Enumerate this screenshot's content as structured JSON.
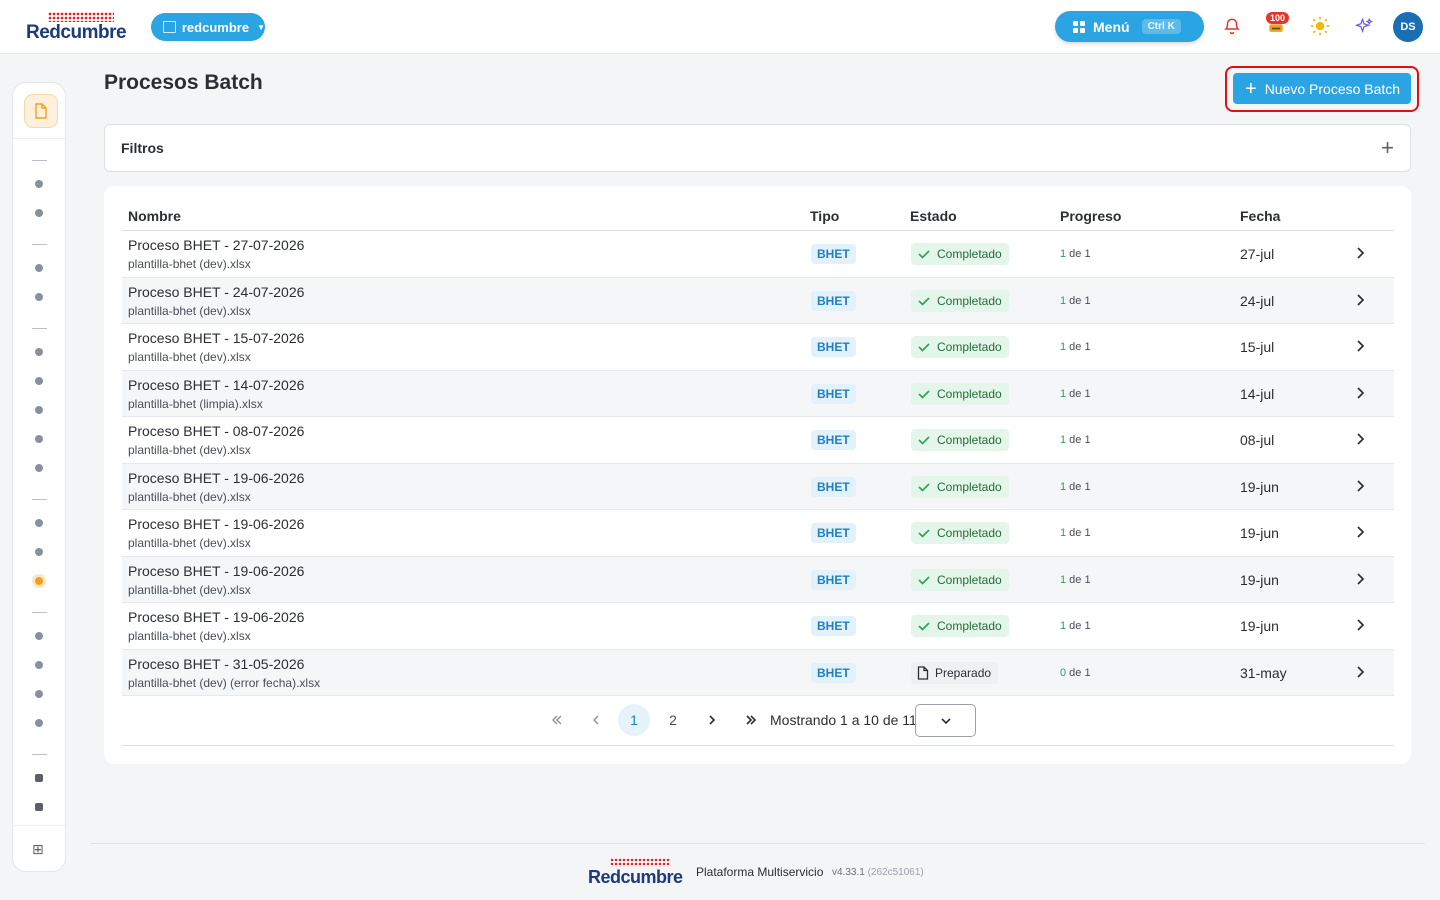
{
  "header": {
    "logo_text": "Redcumbre",
    "org_selector": "redcumbre",
    "menu_label": "Menú",
    "menu_shortcut": "Ctrl K",
    "notification_count": "100",
    "avatar_initials": "DS"
  },
  "page": {
    "title": "Procesos Batch",
    "new_button": "Nuevo Proceso Batch",
    "filters_label": "Filtros"
  },
  "table": {
    "columns": [
      "Nombre",
      "Tipo",
      "Estado",
      "Progreso",
      "Fecha"
    ],
    "rows": [
      {
        "name": "Proceso BHET - 27-07-2026",
        "file": "plantilla-bhet (dev).xlsx",
        "type": "BHET",
        "status": "Completado",
        "progress_done": "1",
        "progress_rest": " de 1",
        "date": "27-jul"
      },
      {
        "name": "Proceso BHET - 24-07-2026",
        "file": "plantilla-bhet (dev).xlsx",
        "type": "BHET",
        "status": "Completado",
        "progress_done": "1",
        "progress_rest": " de 1",
        "date": "24-jul"
      },
      {
        "name": "Proceso BHET - 15-07-2026",
        "file": "plantilla-bhet (dev).xlsx",
        "type": "BHET",
        "status": "Completado",
        "progress_done": "1",
        "progress_rest": " de 1",
        "date": "15-jul"
      },
      {
        "name": "Proceso BHET - 14-07-2026",
        "file": "plantilla-bhet (limpia).xlsx",
        "type": "BHET",
        "status": "Completado",
        "progress_done": "1",
        "progress_rest": " de 1",
        "date": "14-jul"
      },
      {
        "name": "Proceso BHET - 08-07-2026",
        "file": "plantilla-bhet (dev).xlsx",
        "type": "BHET",
        "status": "Completado",
        "progress_done": "1",
        "progress_rest": " de 1",
        "date": "08-jul"
      },
      {
        "name": "Proceso BHET - 19-06-2026",
        "file": "plantilla-bhet (dev).xlsx",
        "type": "BHET",
        "status": "Completado",
        "progress_done": "1",
        "progress_rest": " de 1",
        "date": "19-jun"
      },
      {
        "name": "Proceso BHET - 19-06-2026",
        "file": "plantilla-bhet (dev).xlsx",
        "type": "BHET",
        "status": "Completado",
        "progress_done": "1",
        "progress_rest": " de 1",
        "date": "19-jun"
      },
      {
        "name": "Proceso BHET - 19-06-2026",
        "file": "plantilla-bhet (dev).xlsx",
        "type": "BHET",
        "status": "Completado",
        "progress_done": "1",
        "progress_rest": " de 1",
        "date": "19-jun"
      },
      {
        "name": "Proceso BHET - 19-06-2026",
        "file": "plantilla-bhet (dev).xlsx",
        "type": "BHET",
        "status": "Completado",
        "progress_done": "1",
        "progress_rest": " de 1",
        "date": "19-jun"
      },
      {
        "name": "Proceso BHET - 31-05-2026",
        "file": "plantilla-bhet (dev) (error fecha).xlsx",
        "type": "BHET",
        "status": "Preparado",
        "progress_done": "0",
        "progress_rest": " de 1",
        "date": "31-may"
      }
    ]
  },
  "pagination": {
    "pages": [
      "1",
      "2"
    ],
    "current": "1",
    "info": "Mostrando 1 a 10 de 11"
  },
  "footer": {
    "logo_text": "Redcumbre",
    "platform": "Plataforma Multiservicio",
    "version": "v4.33.1",
    "build": "(262c51061)"
  },
  "colors": {
    "primary": "#2aa4e2",
    "success_bg": "#e4f6ea",
    "highlight_border": "#e01010",
    "rail_active": "#f0a020"
  }
}
